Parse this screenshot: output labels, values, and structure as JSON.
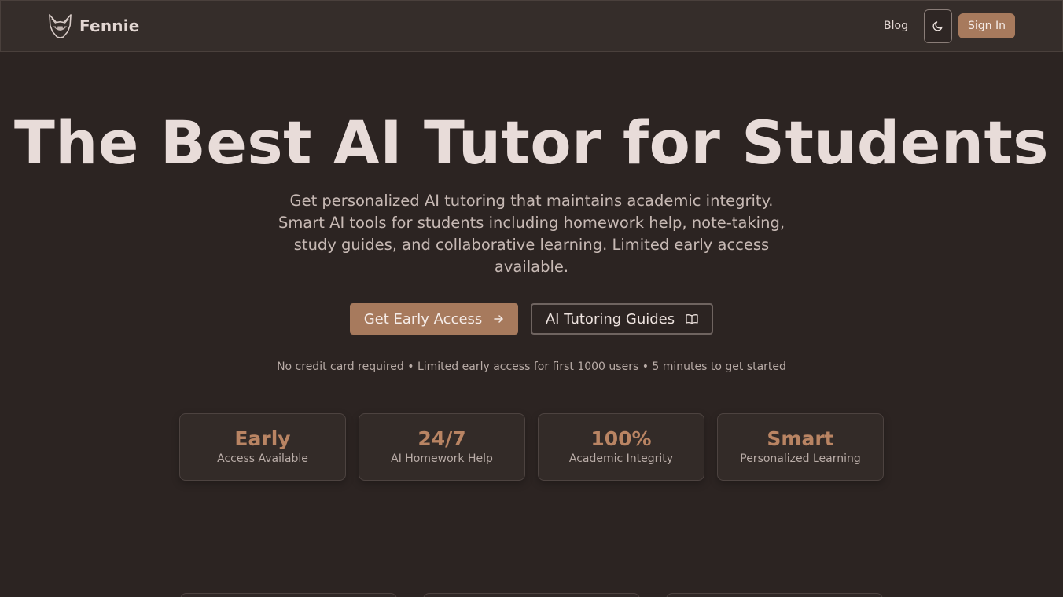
{
  "header": {
    "brand": "Fennie",
    "nav_blog": "Blog",
    "sign_in": "Sign In",
    "logo_icon": "fox-logo-icon",
    "theme_icon": "moon-icon"
  },
  "hero": {
    "title": "The Best AI Tutor for Students",
    "subtitle": "Get personalized AI tutoring that maintains academic integrity. Smart AI tools for students including homework help, note-taking, study guides, and collaborative learning. Limited early access available.",
    "primary_cta": "Get Early Access",
    "primary_icon": "arrow-right-icon",
    "secondary_cta": "AI Tutoring Guides",
    "secondary_icon": "book-open-icon",
    "fineprint": "No credit card required • Limited early access for first 1000 users • 5 minutes to get started"
  },
  "stats": [
    {
      "value": "Early",
      "label": "Access Available"
    },
    {
      "value": "24/7",
      "label": "AI Homework Help"
    },
    {
      "value": "100%",
      "label": "Academic Integrity"
    },
    {
      "value": "Smart",
      "label": "Personalized Learning"
    }
  ],
  "colors": {
    "background": "#2c2422",
    "accent": "#a77a5d",
    "stat_value": "#b98463"
  }
}
